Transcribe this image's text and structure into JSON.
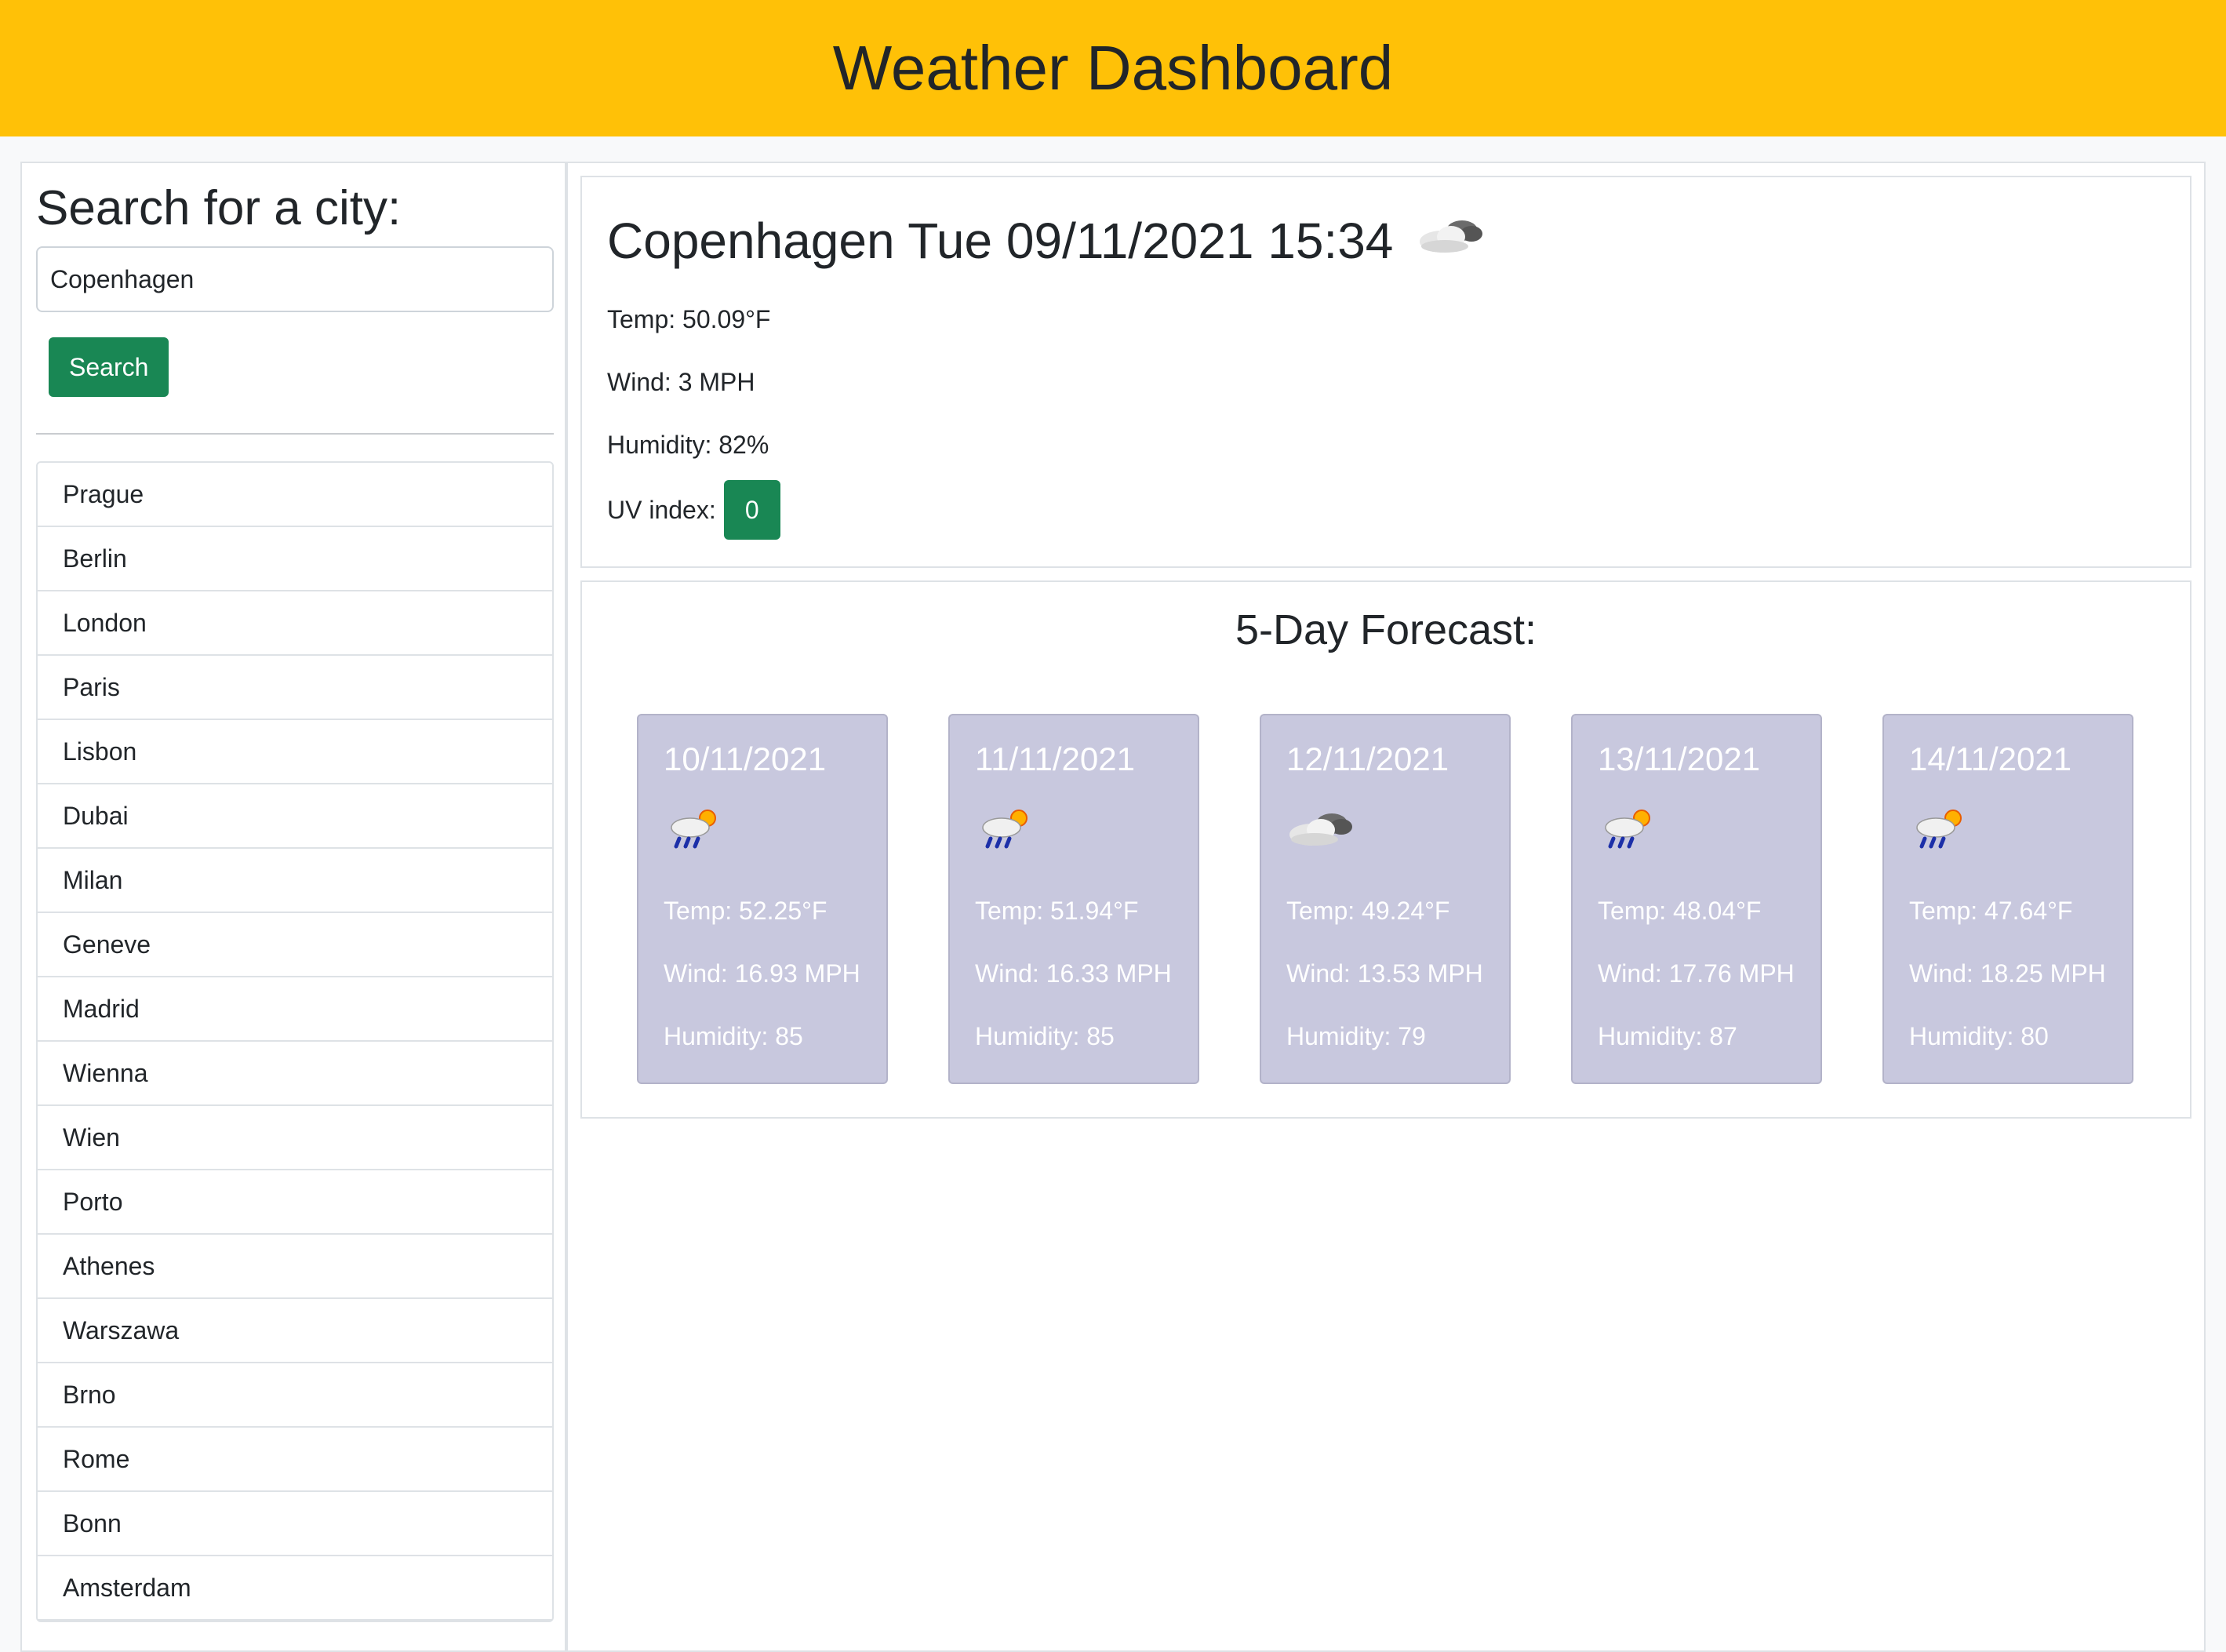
{
  "header": {
    "title": "Weather Dashboard"
  },
  "sidebar": {
    "heading": "Search for a city:",
    "search": {
      "value": "Copenhagen",
      "placeholder": ""
    },
    "search_button": "Search",
    "cities": [
      "Prague",
      "Berlin",
      "London",
      "Paris",
      "Lisbon",
      "Dubai",
      "Milan",
      "Geneve",
      "Madrid",
      "Wienna",
      "Wien",
      "Porto",
      "Athenes",
      "Warszawa",
      "Brno",
      "Rome",
      "Bonn",
      "Amsterdam"
    ]
  },
  "current": {
    "title": "Copenhagen Tue 09/11/2021 15:34",
    "icon": "cloud-icon",
    "temp": "Temp: 50.09°F",
    "wind": "Wind: 3 MPH",
    "humidity": "Humidity: 82%",
    "uv_label": "UV index:",
    "uv_value": "0",
    "uv_color": "#198754"
  },
  "forecast": {
    "heading": "5-Day Forecast:",
    "days": [
      {
        "date": "10/11/2021",
        "icon": "rain-sun-icon",
        "temp": "Temp: 52.25°F",
        "wind": "Wind: 16.93 MPH",
        "humidity": "Humidity: 85"
      },
      {
        "date": "11/11/2021",
        "icon": "rain-sun-icon",
        "temp": "Temp: 51.94°F",
        "wind": "Wind: 16.33 MPH",
        "humidity": "Humidity: 85"
      },
      {
        "date": "12/11/2021",
        "icon": "cloud-icon",
        "temp": "Temp: 49.24°F",
        "wind": "Wind: 13.53 MPH",
        "humidity": "Humidity: 79"
      },
      {
        "date": "13/11/2021",
        "icon": "rain-sun-icon",
        "temp": "Temp: 48.04°F",
        "wind": "Wind: 17.76 MPH",
        "humidity": "Humidity: 87"
      },
      {
        "date": "14/11/2021",
        "icon": "rain-sun-icon",
        "temp": "Temp: 47.64°F",
        "wind": "Wind: 18.25 MPH",
        "humidity": "Humidity: 80"
      }
    ]
  },
  "colors": {
    "header_bg": "#ffc107",
    "button_green": "#198754",
    "card_bg": "#c8c8de"
  }
}
